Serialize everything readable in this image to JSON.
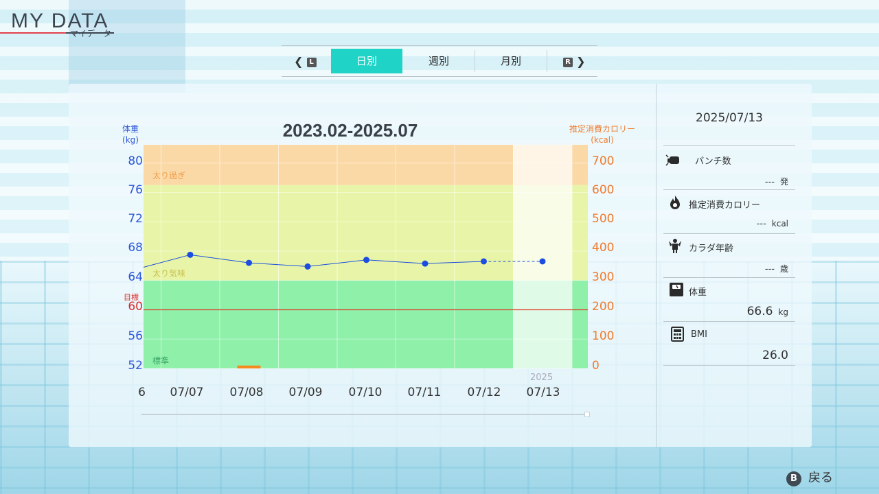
{
  "header": {
    "title": "MY DATA",
    "subtitle": "マイデータ"
  },
  "tabs": {
    "prev_button": "L",
    "next_button": "R",
    "items": [
      {
        "label": "日別",
        "active": true
      },
      {
        "label": "週別",
        "active": false
      },
      {
        "label": "月別",
        "active": false
      }
    ]
  },
  "chart": {
    "title": "2023.02-2025.07",
    "left_axis_title": "体重",
    "left_axis_unit": "(kg)",
    "right_axis_title": "推定消費カロリー",
    "right_axis_unit": "(kcal)",
    "goal_label": "目標",
    "zone_labels": {
      "overweight": "太り過ぎ",
      "slightly_overweight": "太り気味",
      "normal": "標準"
    },
    "year_label": "2025",
    "first_partial_label": "6"
  },
  "chart_data": {
    "type": "line",
    "title": "2023.02-2025.07",
    "x": [
      "07/07",
      "07/08",
      "07/09",
      "07/10",
      "07/11",
      "07/12",
      "07/13"
    ],
    "series": [
      {
        "values": [
          67.5,
          66.4,
          65.9,
          66.8,
          66.3,
          66.6,
          66.6
        ],
        "color": "#1b4ee0"
      }
    ],
    "bars": [
      {
        "x": "07/08",
        "value": 10,
        "color": "#f58a1f"
      }
    ],
    "y_left": {
      "ticks": [
        "80",
        "76",
        "72",
        "68",
        "64",
        "60",
        "56",
        "52"
      ],
      "ylim": [
        52,
        82.5
      ]
    },
    "y_right": {
      "ticks": [
        "700",
        "600",
        "500",
        "400",
        "300",
        "200",
        "100",
        "0"
      ],
      "ylim": [
        0,
        770
      ]
    },
    "goal_value": 60,
    "zones": [
      {
        "name": "太り過ぎ",
        "from": 77,
        "to": 82.5,
        "color": "#fbd9a6"
      },
      {
        "name": "太り気味",
        "from": 64,
        "to": 77,
        "color": "#e8f5a8"
      },
      {
        "name": "標準",
        "from": 52,
        "to": 64,
        "color": "#8ef0a9"
      }
    ],
    "grid": true
  },
  "sidebar": {
    "date": "2025/07/13",
    "stats": [
      {
        "label": "パンチ数",
        "value": "---",
        "unit": "発",
        "icon": "punch-icon"
      },
      {
        "label": "推定消費カロリー",
        "value": "---",
        "unit": "kcal",
        "icon": "flame-icon"
      },
      {
        "label": "カラダ年齢",
        "value": "---",
        "unit": "歳",
        "icon": "muscle-icon"
      },
      {
        "label": "体重",
        "value": "66.6",
        "unit": "kg",
        "icon": "scale-icon"
      },
      {
        "label": "BMI",
        "value": "26.0",
        "unit": "",
        "icon": "calculator-icon"
      }
    ]
  },
  "footer": {
    "back_button": "B",
    "back_label": "戻る"
  },
  "colors": {
    "accent": "#1fd3c6",
    "left_axis": "#2d57d8",
    "right_axis": "#f07a2a",
    "goal_line": "#e02828"
  }
}
